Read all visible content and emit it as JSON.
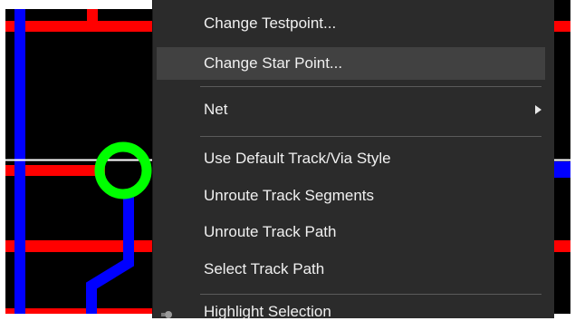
{
  "context_menu": {
    "items": [
      {
        "label": "Change Testpoint..."
      },
      {
        "label": "Change Star Point..."
      },
      {
        "label": "Net"
      },
      {
        "label": "Use Default Track/Via Style"
      },
      {
        "label": "Unroute Track Segments"
      },
      {
        "label": "Unroute Track Path"
      },
      {
        "label": "Select Track Path"
      },
      {
        "label": "Highlight Selection"
      }
    ],
    "hovered_item": "Change Star Point...",
    "submenu_item": "Net"
  },
  "colors": {
    "menu_bg": "#2b2b2b",
    "menu_highlight": "#414141",
    "menu_text": "#f0f0f0",
    "separator": "#5a5a5a",
    "pcb_bg": "#000000",
    "track_red": "#ff0000",
    "track_blue": "#0000ff",
    "pad_green": "#00ff00"
  }
}
